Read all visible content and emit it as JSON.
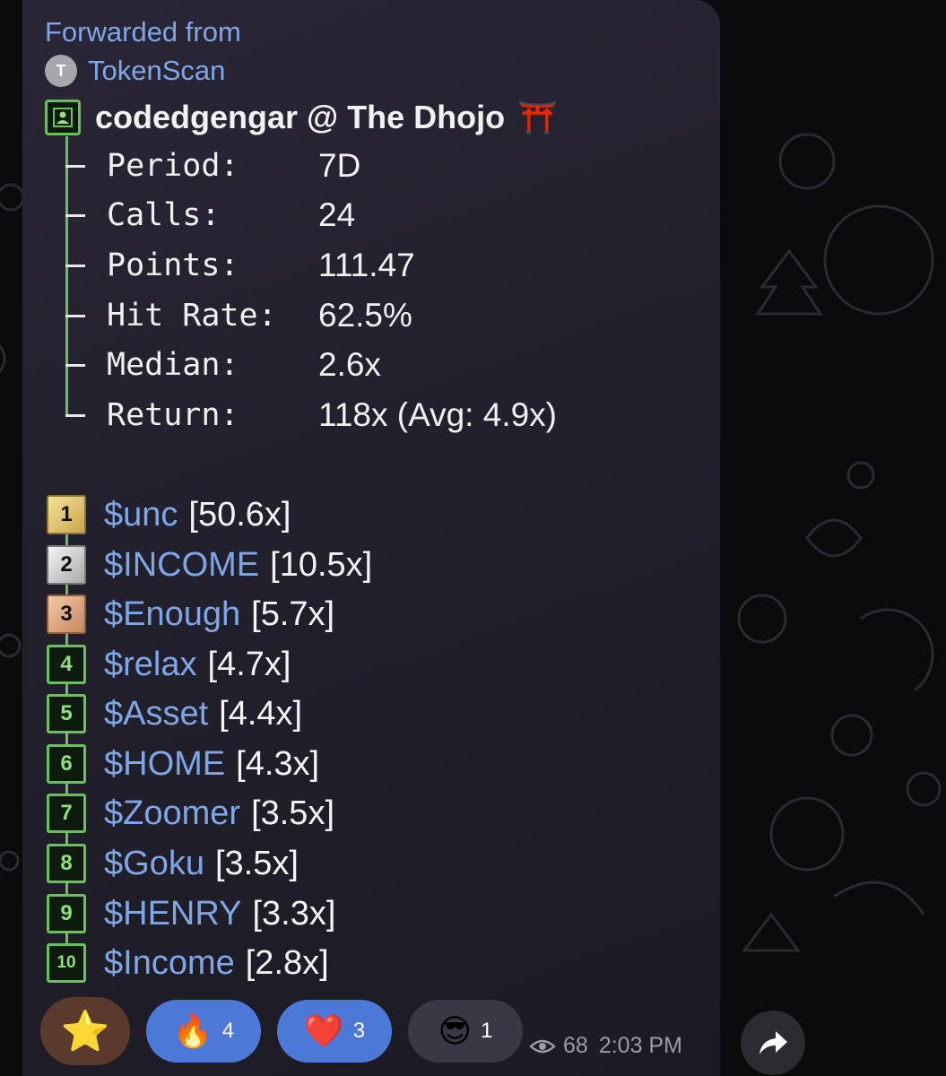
{
  "forward": {
    "label": "Forwarded from",
    "source_initial": "T",
    "source_name": "TokenScan"
  },
  "header": {
    "title": "codedgengar @ The Dhojo",
    "emoji": "⛩️"
  },
  "stats": [
    {
      "label": "Period:",
      "value": "7D"
    },
    {
      "label": "Calls:",
      "value": "24"
    },
    {
      "label": "Points:",
      "value": "111.47"
    },
    {
      "label": "Hit Rate:",
      "value": "62.5%"
    },
    {
      "label": "Median:",
      "value": "2.6x"
    },
    {
      "label": "Return:",
      "value": "118x (Avg: 4.9x)"
    }
  ],
  "ranking": [
    {
      "rank": "1",
      "ticker": "$unc",
      "mult": "[50.6x]",
      "medal": "gold"
    },
    {
      "rank": "2",
      "ticker": "$INCOME",
      "mult": "[10.5x]",
      "medal": "silver"
    },
    {
      "rank": "3",
      "ticker": "$Enough",
      "mult": "[5.7x]",
      "medal": "bronze"
    },
    {
      "rank": "4",
      "ticker": "$relax",
      "mult": "[4.7x]",
      "medal": "green"
    },
    {
      "rank": "5",
      "ticker": "$Asset",
      "mult": "[4.4x]",
      "medal": "green"
    },
    {
      "rank": "6",
      "ticker": "$HOME",
      "mult": "[4.3x]",
      "medal": "green"
    },
    {
      "rank": "7",
      "ticker": "$Zoomer",
      "mult": "[3.5x]",
      "medal": "green"
    },
    {
      "rank": "8",
      "ticker": "$Goku",
      "mult": "[3.5x]",
      "medal": "green"
    },
    {
      "rank": "9",
      "ticker": "$HENRY",
      "mult": "[3.3x]",
      "medal": "green"
    },
    {
      "rank": "10",
      "ticker": "$Income",
      "mult": "[2.8x]",
      "medal": "green"
    }
  ],
  "reactions": {
    "star": {
      "emoji": "⭐"
    },
    "fire": {
      "emoji": "🔥",
      "count": "4"
    },
    "heart": {
      "emoji": "❤️",
      "count": "3"
    },
    "sticker": {
      "emoji": "😎",
      "count": "1"
    }
  },
  "meta": {
    "views": "68",
    "time": "2:03 PM"
  },
  "colors": {
    "link": "#7fa7e8",
    "green": "#6cbf5e",
    "reaction_blue": "#4c78d8"
  }
}
